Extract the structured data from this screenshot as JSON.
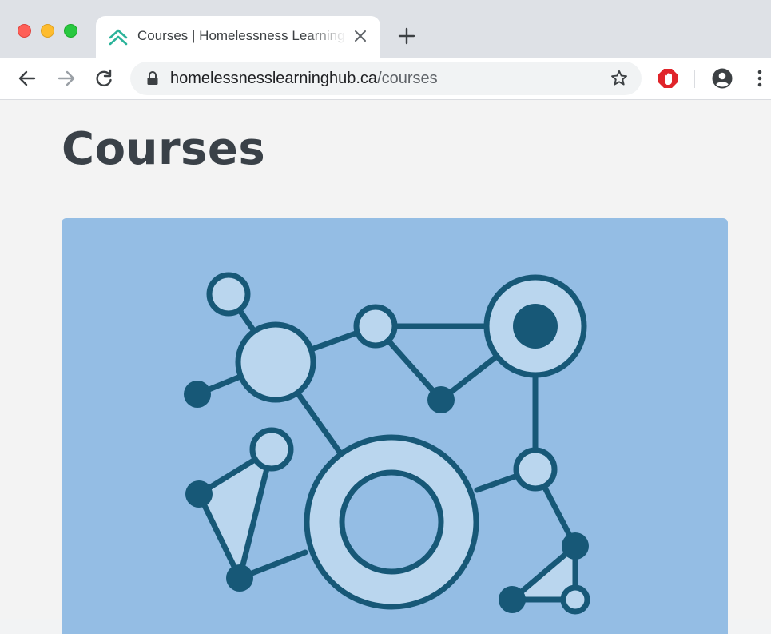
{
  "browser": {
    "tab": {
      "title": "Courses | Homelessness Learning Hub",
      "favicon": "chevrons-up-icon",
      "close_icon": "close-icon"
    },
    "new_tab_icon": "plus-icon",
    "nav": {
      "back_icon": "arrow-left-icon",
      "forward_icon": "arrow-right-icon",
      "reload_icon": "reload-icon"
    },
    "address": {
      "host": "homelessnesslearninghub.ca",
      "path": "/courses",
      "lock_icon": "lock-icon",
      "bookmark_icon": "star-icon"
    },
    "extensions": {
      "stop_icon": "stop-sign-icon",
      "profile_icon": "account-circle-icon",
      "menu_icon": "kebab-menu-icon"
    },
    "colors": {
      "tab_strip": "#dee1e6",
      "traffic_red": "#fe5f57",
      "traffic_yellow": "#febc2e",
      "traffic_green": "#28c840",
      "favicon_teal": "#2bb39a",
      "stop_red": "#e0242a"
    }
  },
  "page": {
    "title": "Courses",
    "colors": {
      "card_bg": "#94bde4",
      "node_stroke": "#175877",
      "node_fill": "#bad6ee",
      "node_dark": "#175877"
    }
  }
}
